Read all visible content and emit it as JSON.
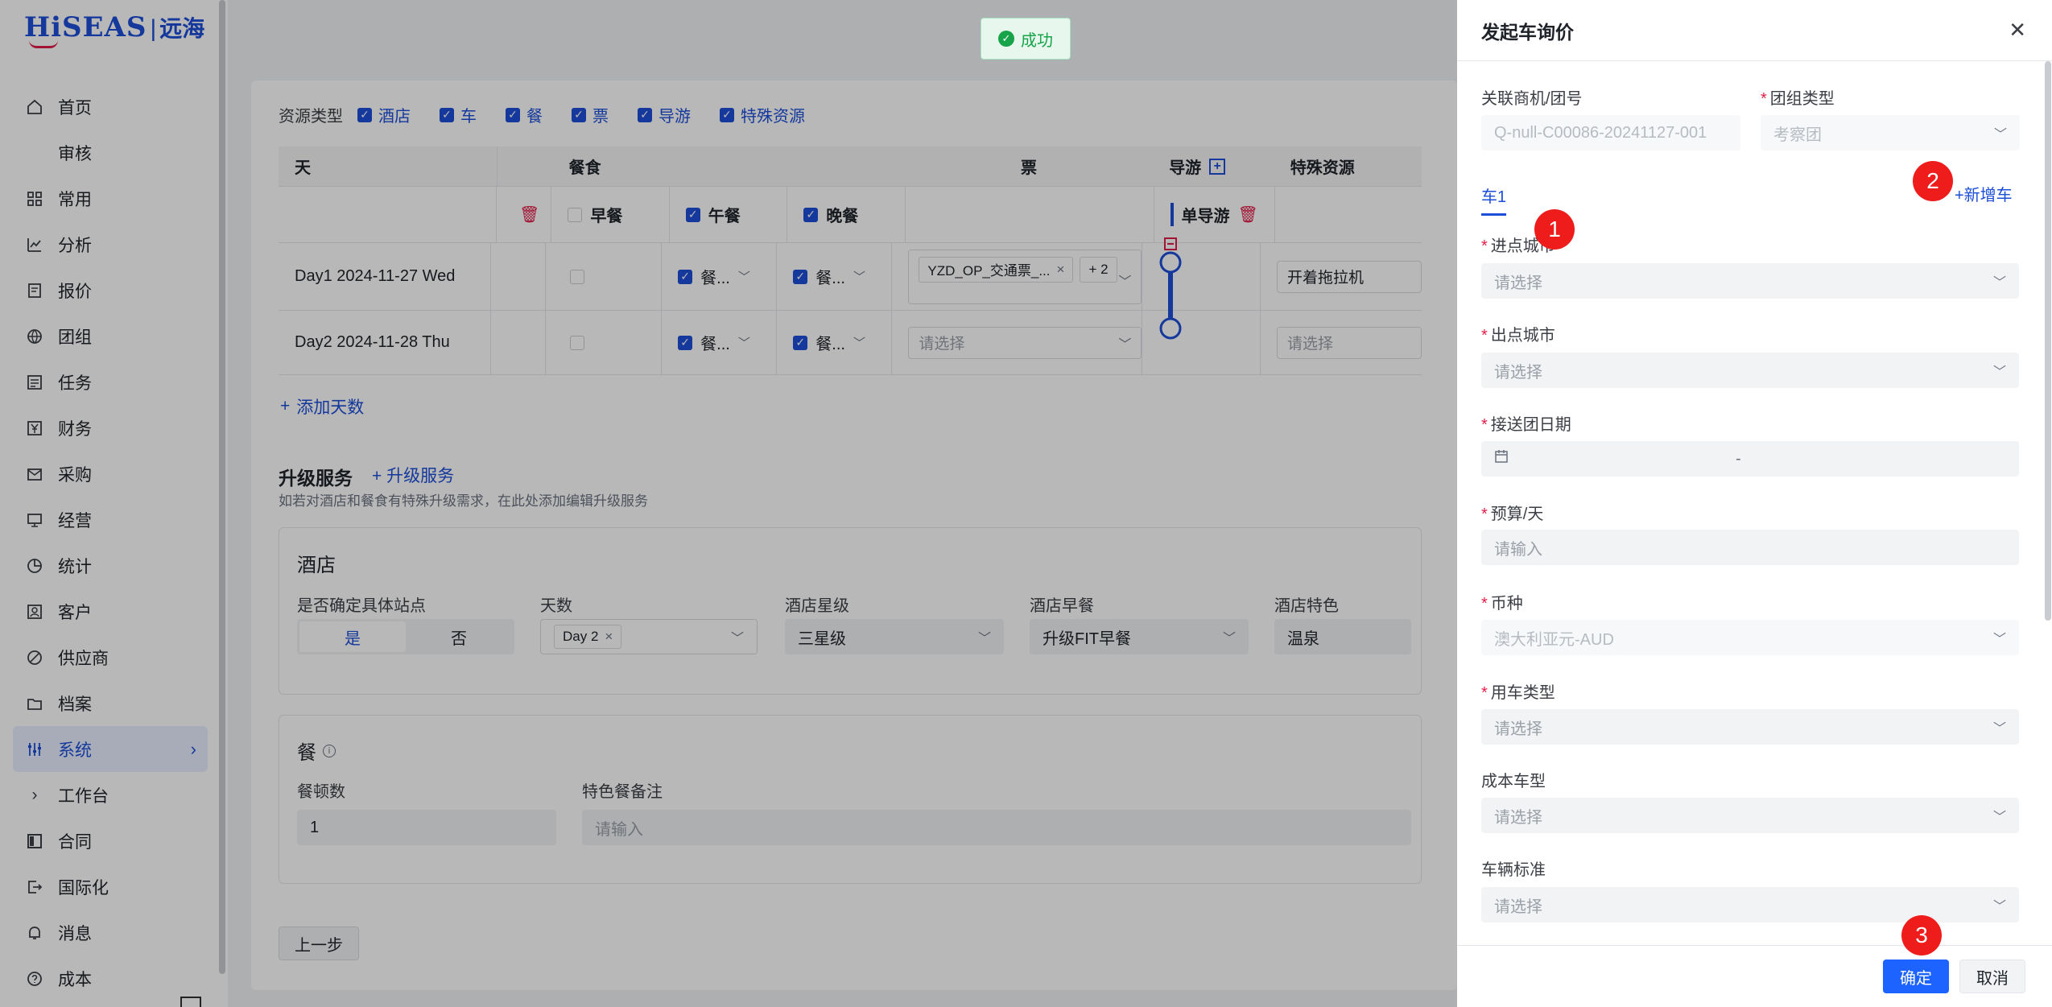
{
  "logo": {
    "hi": "HiSEAS",
    "cn": "远海"
  },
  "sidebar": {
    "items": [
      {
        "label": "首页"
      },
      {
        "label": "审核"
      },
      {
        "label": "常用"
      },
      {
        "label": "分析"
      },
      {
        "label": "报价"
      },
      {
        "label": "团组"
      },
      {
        "label": "任务"
      },
      {
        "label": "财务"
      },
      {
        "label": "采购"
      },
      {
        "label": "经营"
      },
      {
        "label": "统计"
      },
      {
        "label": "客户"
      },
      {
        "label": "供应商"
      },
      {
        "label": "档案"
      },
      {
        "label": "系统"
      },
      {
        "label": "工作台"
      },
      {
        "label": "合同"
      },
      {
        "label": "国际化"
      },
      {
        "label": "消息"
      },
      {
        "label": "成本"
      }
    ]
  },
  "toast": {
    "text": "成功"
  },
  "resource": {
    "label": "资源类型",
    "items": [
      "酒店",
      "车",
      "餐",
      "票",
      "导游",
      "特殊资源"
    ]
  },
  "table": {
    "headers": {
      "day": "天",
      "meal": "餐食",
      "ticket": "票",
      "guide": "导游",
      "special": "特殊资源"
    },
    "subheaders": {
      "breakfast": "早餐",
      "lunch": "午餐",
      "dinner": "晚餐",
      "single_guide": "单导游"
    },
    "rows": [
      {
        "day": "Day1 2024-11-27 Wed",
        "lunch": "餐...",
        "dinner": "餐...",
        "ticket_tag": "YZD_OP_交通票_...",
        "ticket_more": "+ 2",
        "special": "开着拖拉机"
      },
      {
        "day": "Day2 2024-11-28 Thu",
        "lunch": "餐...",
        "dinner": "餐...",
        "ticket_placeholder": "请选择",
        "special": "请选择"
      }
    ],
    "add_day": "添加天数"
  },
  "upgrade": {
    "title": "升级服务",
    "add": "升级服务",
    "desc": "如若对酒店和餐食有特殊升级需求，在此处添加编辑升级服务",
    "hotel": {
      "title": "酒店",
      "site_label": "是否确定具体站点",
      "site_yes": "是",
      "site_no": "否",
      "days_label": "天数",
      "days_tag": "Day 2",
      "star_label": "酒店星级",
      "star_value": "三星级",
      "breakfast_label": "酒店早餐",
      "breakfast_value": "升级FIT早餐",
      "feature_label": "酒店特色",
      "feature_value": "温泉"
    },
    "meal": {
      "title": "餐",
      "count_label": "餐顿数",
      "count_value": "1",
      "note_label": "特色餐备注",
      "note_placeholder": "请输入"
    }
  },
  "prev_button": "上一步",
  "drawer": {
    "title": "发起车询价",
    "related_label": "关联商机/团号",
    "related_value": "Q-null-C00086-20241127-001",
    "group_type_label": "团组类型",
    "group_type_value": "考察团",
    "tab": "车1",
    "add_car": "+新增车",
    "fields": [
      {
        "label": "进点城市",
        "required": true,
        "placeholder": "请选择"
      },
      {
        "label": "出点城市",
        "required": true,
        "placeholder": "请选择"
      },
      {
        "label": "接送团日期",
        "required": true,
        "placeholder": "-"
      },
      {
        "label": "预算/天",
        "required": true,
        "placeholder": "请输入"
      },
      {
        "label": "币种",
        "required": true,
        "placeholder": "澳大利亚元-AUD"
      },
      {
        "label": "用车类型",
        "required": true,
        "placeholder": "请选择"
      },
      {
        "label": "成本车型",
        "required": false,
        "placeholder": "请选择"
      },
      {
        "label": "车辆标准",
        "required": false,
        "placeholder": "请选择"
      }
    ],
    "ok": "确定",
    "cancel": "取消"
  },
  "badges": [
    "1",
    "2",
    "3"
  ]
}
